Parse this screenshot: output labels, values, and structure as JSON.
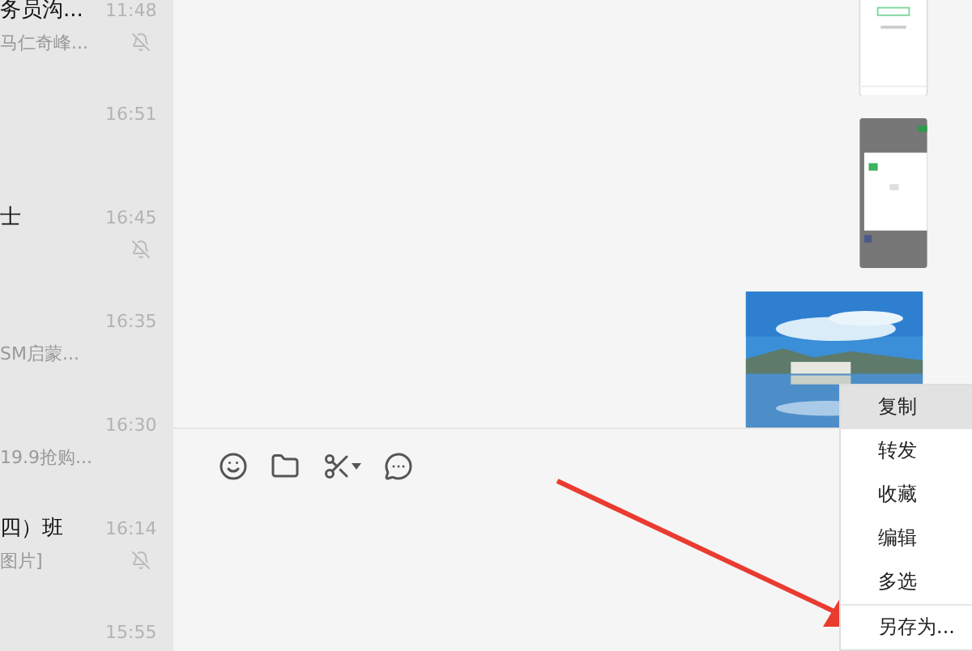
{
  "chat_list": [
    {
      "title": "务员沟...",
      "time": "11:48",
      "preview": "马仁奇峰...",
      "muted": true
    },
    {
      "time": "16:51",
      "muted": false
    },
    {
      "title": "士",
      "time": "16:45",
      "muted": true
    },
    {
      "time": "16:35",
      "preview": "SM启蒙...",
      "muted": false
    },
    {
      "time": "16:30",
      "preview": "19.9抢购...",
      "muted": false
    },
    {
      "title": "四）班",
      "time": "16:14",
      "preview": "图片]",
      "muted": true
    },
    {
      "time": "15:55",
      "muted": false
    }
  ],
  "context_menu": [
    {
      "label": "复制",
      "selected": true
    },
    {
      "label": "转发",
      "selected": false
    },
    {
      "label": "收藏",
      "selected": false
    },
    {
      "label": "编辑",
      "selected": false
    },
    {
      "label": "多选",
      "selected": false
    },
    {
      "label": "另存为...",
      "selected": false
    }
  ]
}
